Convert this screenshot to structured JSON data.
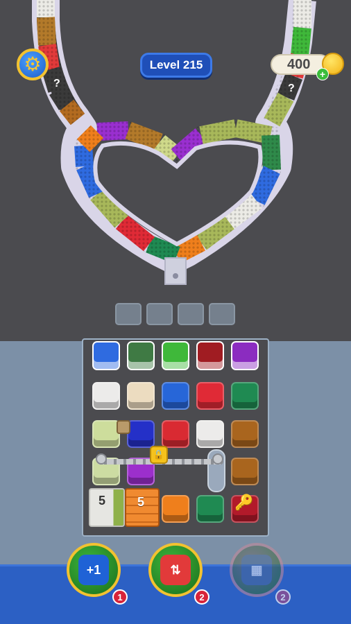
{
  "hud": {
    "level_label": "Level 215",
    "coins": "400",
    "plus": "+"
  },
  "track": {
    "mystery_mark": "?"
  },
  "slots_count": 4,
  "grid": {
    "top_row": [
      "#2f6be0",
      "#3f7a44",
      "#3fb83a",
      "#a01c22",
      "#8b2cc0"
    ],
    "rows": [
      [
        "#ecebea",
        "#ecdcc0",
        "#2766d8",
        "#e02a36",
        "#1f8a52"
      ],
      [
        "#cddd9c",
        "#2430c8",
        "#d92a32",
        "#ecebea",
        "#a9651e"
      ],
      [
        "#ccdca2",
        "#9c2fcc",
        "",
        "",
        "#a9651e"
      ],
      [
        "",
        "",
        "#ef7f1c",
        "#1f8a52",
        "#b21a2a"
      ]
    ],
    "crate_a_count": "5",
    "crate_b_count": "5",
    "lock_symbol": "🔒",
    "key_symbol": "🔑"
  },
  "boosters": [
    {
      "icon_text": "+1",
      "count": "1",
      "color": "#3bb43b",
      "inner": "#1f62d6"
    },
    {
      "icon_text": "⇅",
      "count": "2",
      "color": "#3bb43b",
      "inner": "#e23a3a"
    },
    {
      "icon_text": "▦",
      "count": "2",
      "color": "#7a6a7a",
      "inner": "#4a6a9a"
    }
  ]
}
